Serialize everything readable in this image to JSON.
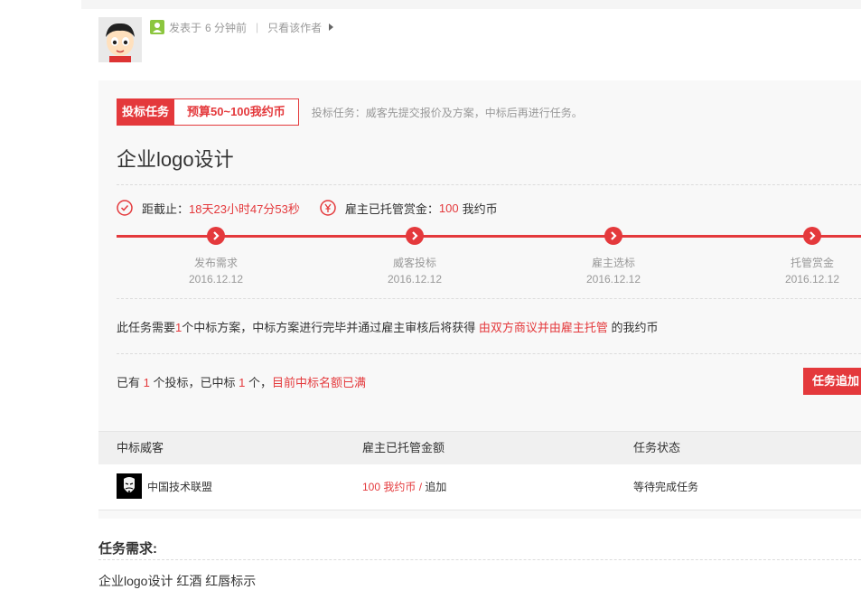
{
  "post": {
    "posted_label": "发表于",
    "time_ago": "6 分钟前",
    "separator": "|",
    "author_only": "只看该作者"
  },
  "task": {
    "type_badge": "投标任务",
    "budget": "预算50~100我约币",
    "type_desc": "投标任务：威客先提交报价及方案，中标后再进行任务。",
    "title": "企业logo设计",
    "deadline_label": "距截止：",
    "deadline_value": "18天23小时47分53秒",
    "escrow_label": "雇主已托管赏金：",
    "escrow_amount": "100",
    "escrow_unit": "我约币",
    "timeline": [
      {
        "label": "发布需求",
        "date": "2016.12.12"
      },
      {
        "label": "威客投标",
        "date": "2016.12.12"
      },
      {
        "label": "雇主选标",
        "date": "2016.12.12"
      },
      {
        "label": "托管赏金",
        "date": "2016.12.12"
      }
    ],
    "desc": {
      "p1": "此任务需要",
      "count": "1",
      "p2": "个中标方案，中标方案进行完毕并通过雇主审核后将获得",
      "reward": "由双方商议并由雇主托管",
      "p3": "的我约币"
    },
    "bids": {
      "p1": "已有",
      "bid_count": "1",
      "p2": "个投标，已中标",
      "win_count": "1",
      "p3": "个，",
      "full": "目前中标名额已满"
    },
    "add_button": "任务追加"
  },
  "table": {
    "headers": [
      "中标威客",
      "雇主已托管金额",
      "任务状态"
    ],
    "rows": [
      {
        "name": "中国技术联盟",
        "amount": "100 我约币",
        "divider": "/",
        "action": "追加",
        "status": "等待完成任务"
      }
    ]
  },
  "requirements": {
    "title": "任务需求:",
    "text": "企业logo设计 红酒 红唇标示"
  },
  "colors": {
    "accent": "#e4393c",
    "muted": "#999999",
    "text": "#333333"
  }
}
